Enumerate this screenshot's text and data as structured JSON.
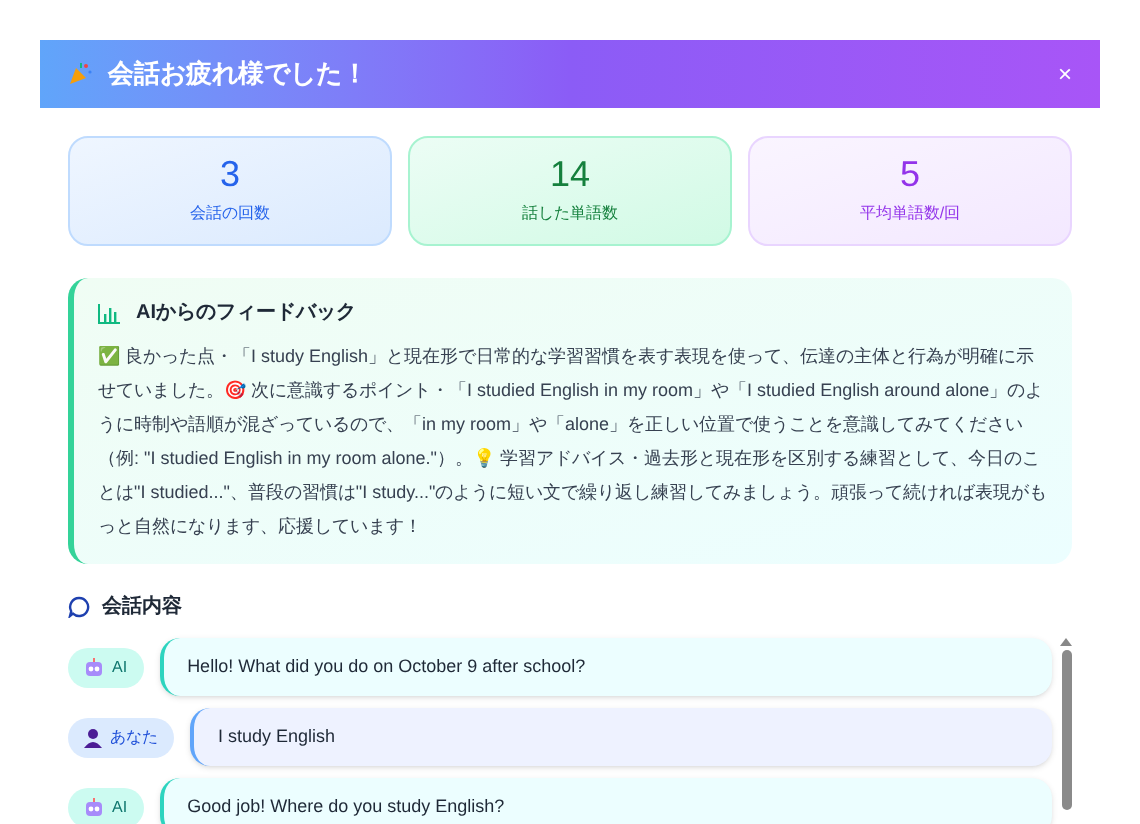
{
  "dialog": {
    "title": "会話お疲れ様でした！",
    "close": "×"
  },
  "stats": [
    {
      "value": "3",
      "label": "会話の回数",
      "color": "#2563eb"
    },
    {
      "value": "14",
      "label": "話した単語数",
      "color": "#15803d"
    },
    {
      "value": "5",
      "label": "平均単語数/回",
      "color": "#9333ea"
    }
  ],
  "feedback": {
    "title": "AIからのフィードバック",
    "text": "✅ 良かった点・「I study English」と現在形で日常的な学習習慣を表す表現を使って、伝達の主体と行為が明確に示せていました。🎯 次に意識するポイント・「I studied English in my room」や「I studied English around alone」のように時制や語順が混ざっているので、「in my room」や「alone」を正しい位置で使うことを意識してみてください（例: \"I studied English in my room alone.\"）。💡 学習アドバイス・過去形と現在形を区別する練習として、今日のことは\"I studied...\"、普段の習慣は\"I study...\"のように短い文で繰り返し練習してみましょう。頑張って続ければ表現がもっと自然になります、応援しています！"
  },
  "conversation": {
    "title": "会話内容",
    "messages": [
      {
        "kind": "ai",
        "speaker": "AI",
        "text": "Hello! What did you do on October 9 after school?"
      },
      {
        "kind": "user",
        "speaker": "あなた",
        "text": "I study English"
      },
      {
        "kind": "ai",
        "speaker": "AI",
        "text": "Good job! Where do you study English?"
      }
    ]
  }
}
